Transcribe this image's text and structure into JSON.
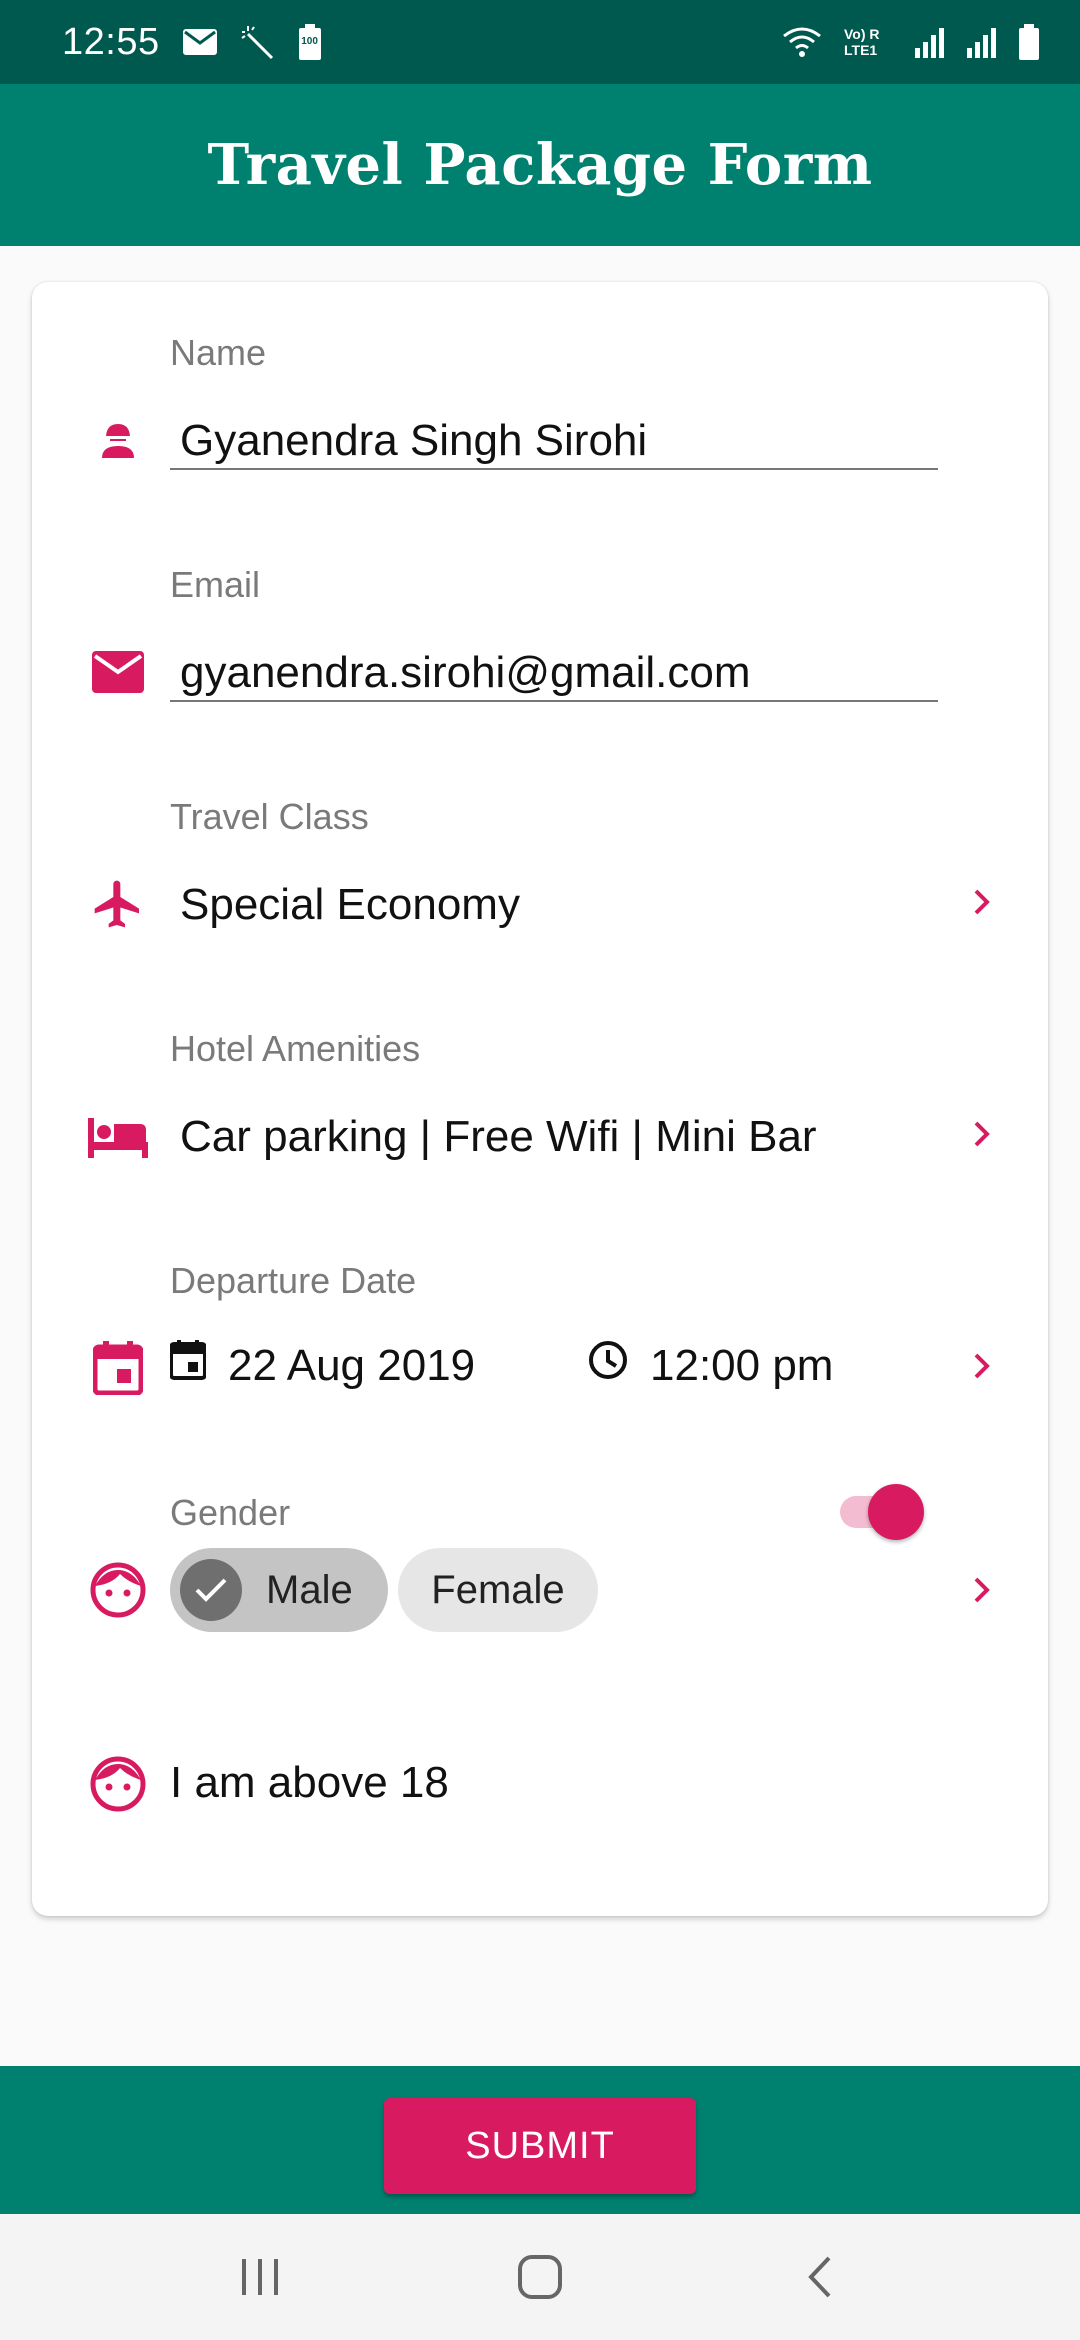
{
  "status_bar": {
    "time": "12:55",
    "battery_badge": "100",
    "network_label": "Vo) R LTE1"
  },
  "app_bar": {
    "title": "Travel Package Form"
  },
  "form": {
    "name": {
      "label": "Name",
      "value": "Gyanendra Singh Sirohi",
      "icon": "person-icon"
    },
    "email": {
      "label": "Email",
      "value": "gyanendra.sirohi@gmail.com",
      "icon": "email-icon"
    },
    "travel_class": {
      "label": "Travel Class",
      "value": "Special Economy",
      "icon": "airplane-icon"
    },
    "hotel_amenities": {
      "label": "Hotel Amenities",
      "value": "Car parking | Free Wifi | Mini Bar",
      "icon": "bed-icon"
    },
    "departure": {
      "label": "Departure Date",
      "date": "22 Aug 2019",
      "time": "12:00 pm",
      "icon": "calendar-icon"
    },
    "gender": {
      "label": "Gender",
      "options": [
        "Male",
        "Female"
      ],
      "selected": "Male",
      "icon": "face-icon"
    },
    "age_toggle": {
      "label": "I am above 18",
      "checked": true,
      "icon": "face-icon"
    }
  },
  "actions": {
    "submit_label": "SUBMIT"
  },
  "colors": {
    "status_bar": "#00594f",
    "primary": "#00806f",
    "accent": "#d81b60"
  }
}
